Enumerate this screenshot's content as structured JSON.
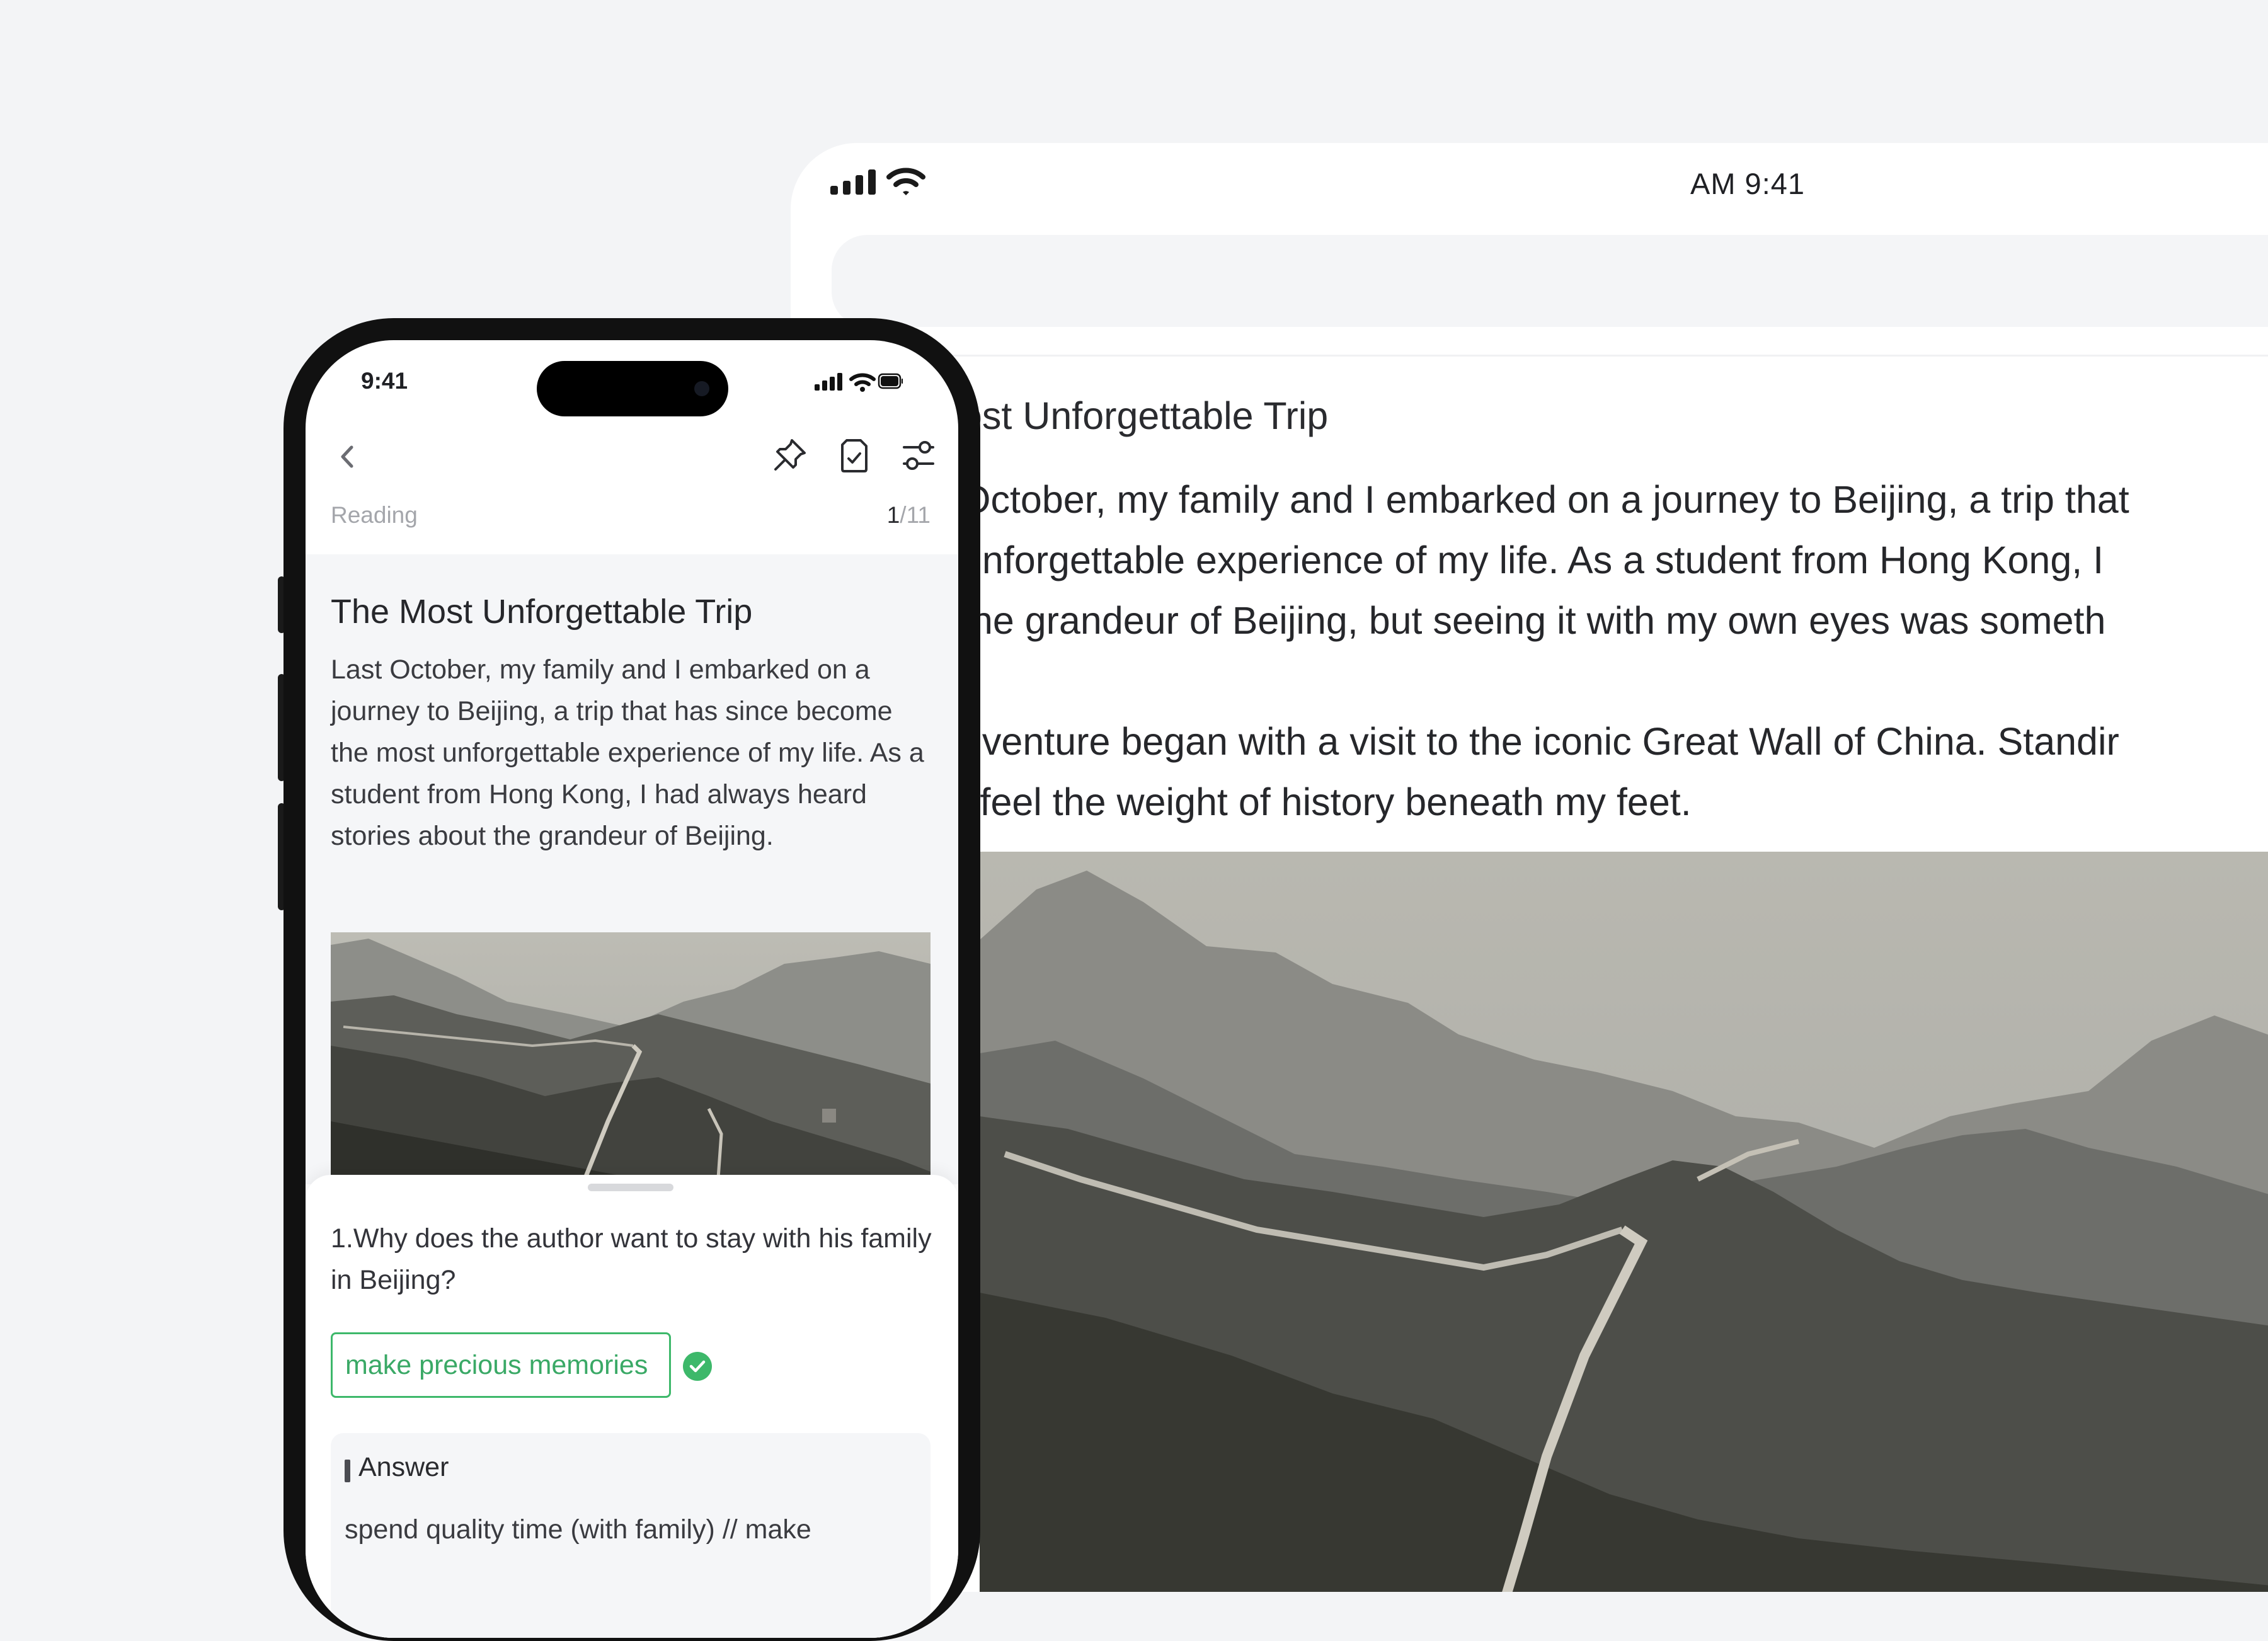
{
  "tablet": {
    "status": {
      "time": "AM 9:41"
    },
    "article": {
      "title": "ost Unforgettable Trip",
      "paragraph1": [
        "October, my family and I embarked on a journey to Beijing, a trip that",
        "unforgettable experience of my life. As a student from Hong Kong, I",
        " the grandeur of Beijing, but seeing it with my own eyes was someth"
      ],
      "paragraph2": [
        "dventure began with a visit to the iconic Great Wall of China. Standir",
        "l feel the weight of history beneath my feet."
      ]
    },
    "photo_icon": "great-wall-photo"
  },
  "phone": {
    "status": {
      "time": "9:41"
    },
    "nav": {
      "back_icon": "chevron-left-icon",
      "icons": [
        "pin-icon",
        "notes-icon",
        "settings-sliders-icon"
      ]
    },
    "section_label": "Reading",
    "page_current": "1",
    "page_total": "/11",
    "article": {
      "title": "The Most Unforgettable Trip",
      "body": "Last October, my family and I embarked on a journey to Beijing, a trip that has since become the most unforgettable experience of my life. As a student from Hong Kong, I had always heard stories about the grandeur of Beijing."
    },
    "quiz": {
      "question": "1.Why does the author want to stay with his family in Beijing?",
      "user_answer": "make precious memories",
      "answer_label": "Answer",
      "answer_text": "spend quality time (with family) // make"
    },
    "colors": {
      "correct": "#3db86a",
      "background": "#f5f6f8"
    }
  }
}
